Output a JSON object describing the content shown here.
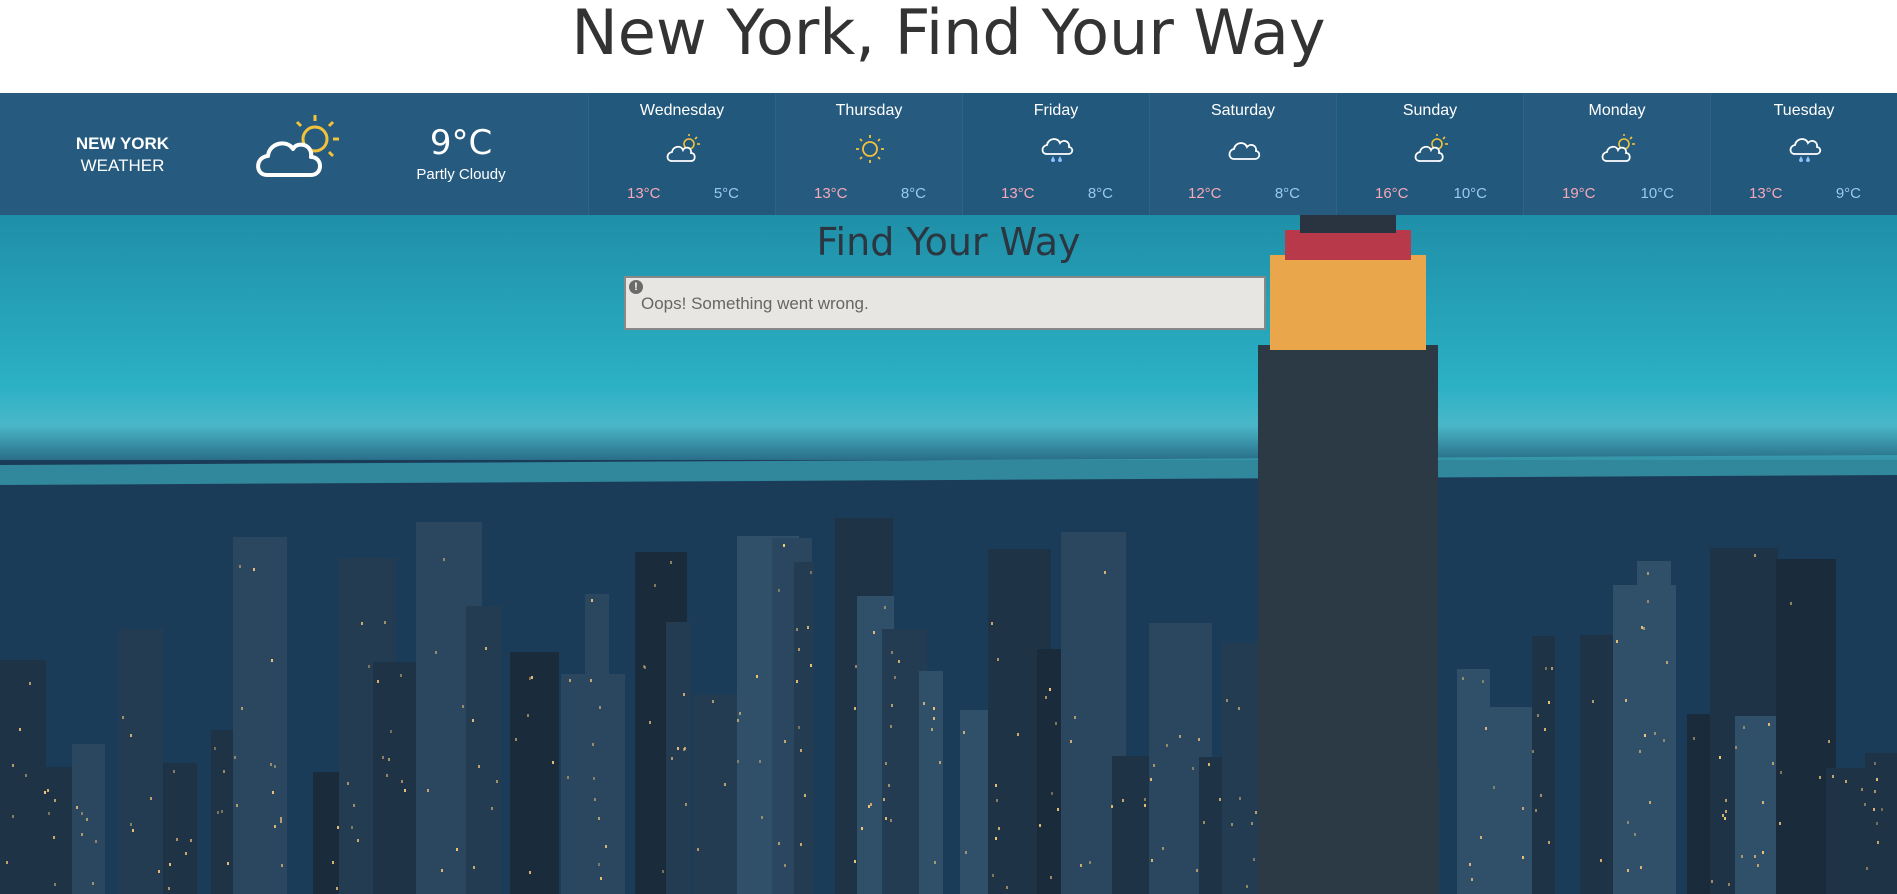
{
  "page": {
    "title": "New York, Find Your Way"
  },
  "weather": {
    "city_line1": "NEW YORK",
    "city_line2": "WEATHER",
    "current_icon": "partly-cloudy-icon",
    "current_temp": "9°C",
    "current_desc": "Partly Cloudy",
    "forecast": [
      {
        "day": "Wednesday",
        "icon": "partly-cloudy-icon",
        "high": "13°C",
        "low": "5°C"
      },
      {
        "day": "Thursday",
        "icon": "sun-icon",
        "high": "13°C",
        "low": "8°C"
      },
      {
        "day": "Friday",
        "icon": "rain-icon",
        "high": "13°C",
        "low": "8°C"
      },
      {
        "day": "Saturday",
        "icon": "cloud-icon",
        "high": "12°C",
        "low": "8°C"
      },
      {
        "day": "Sunday",
        "icon": "partly-cloudy-icon",
        "high": "16°C",
        "low": "10°C"
      },
      {
        "day": "Monday",
        "icon": "partly-cloudy-icon",
        "high": "19°C",
        "low": "10°C"
      },
      {
        "day": "Tuesday",
        "icon": "rain-icon",
        "high": "13°C",
        "low": "9°C"
      }
    ],
    "colors": {
      "bar": "#265b7f",
      "high": "#f7a7b8",
      "low": "#9cc8ee",
      "sun": "#f2c23a"
    }
  },
  "hero": {
    "title": "Find Your Way",
    "error_icon": "error-icon",
    "error_message": "Oops! Something went wrong."
  }
}
